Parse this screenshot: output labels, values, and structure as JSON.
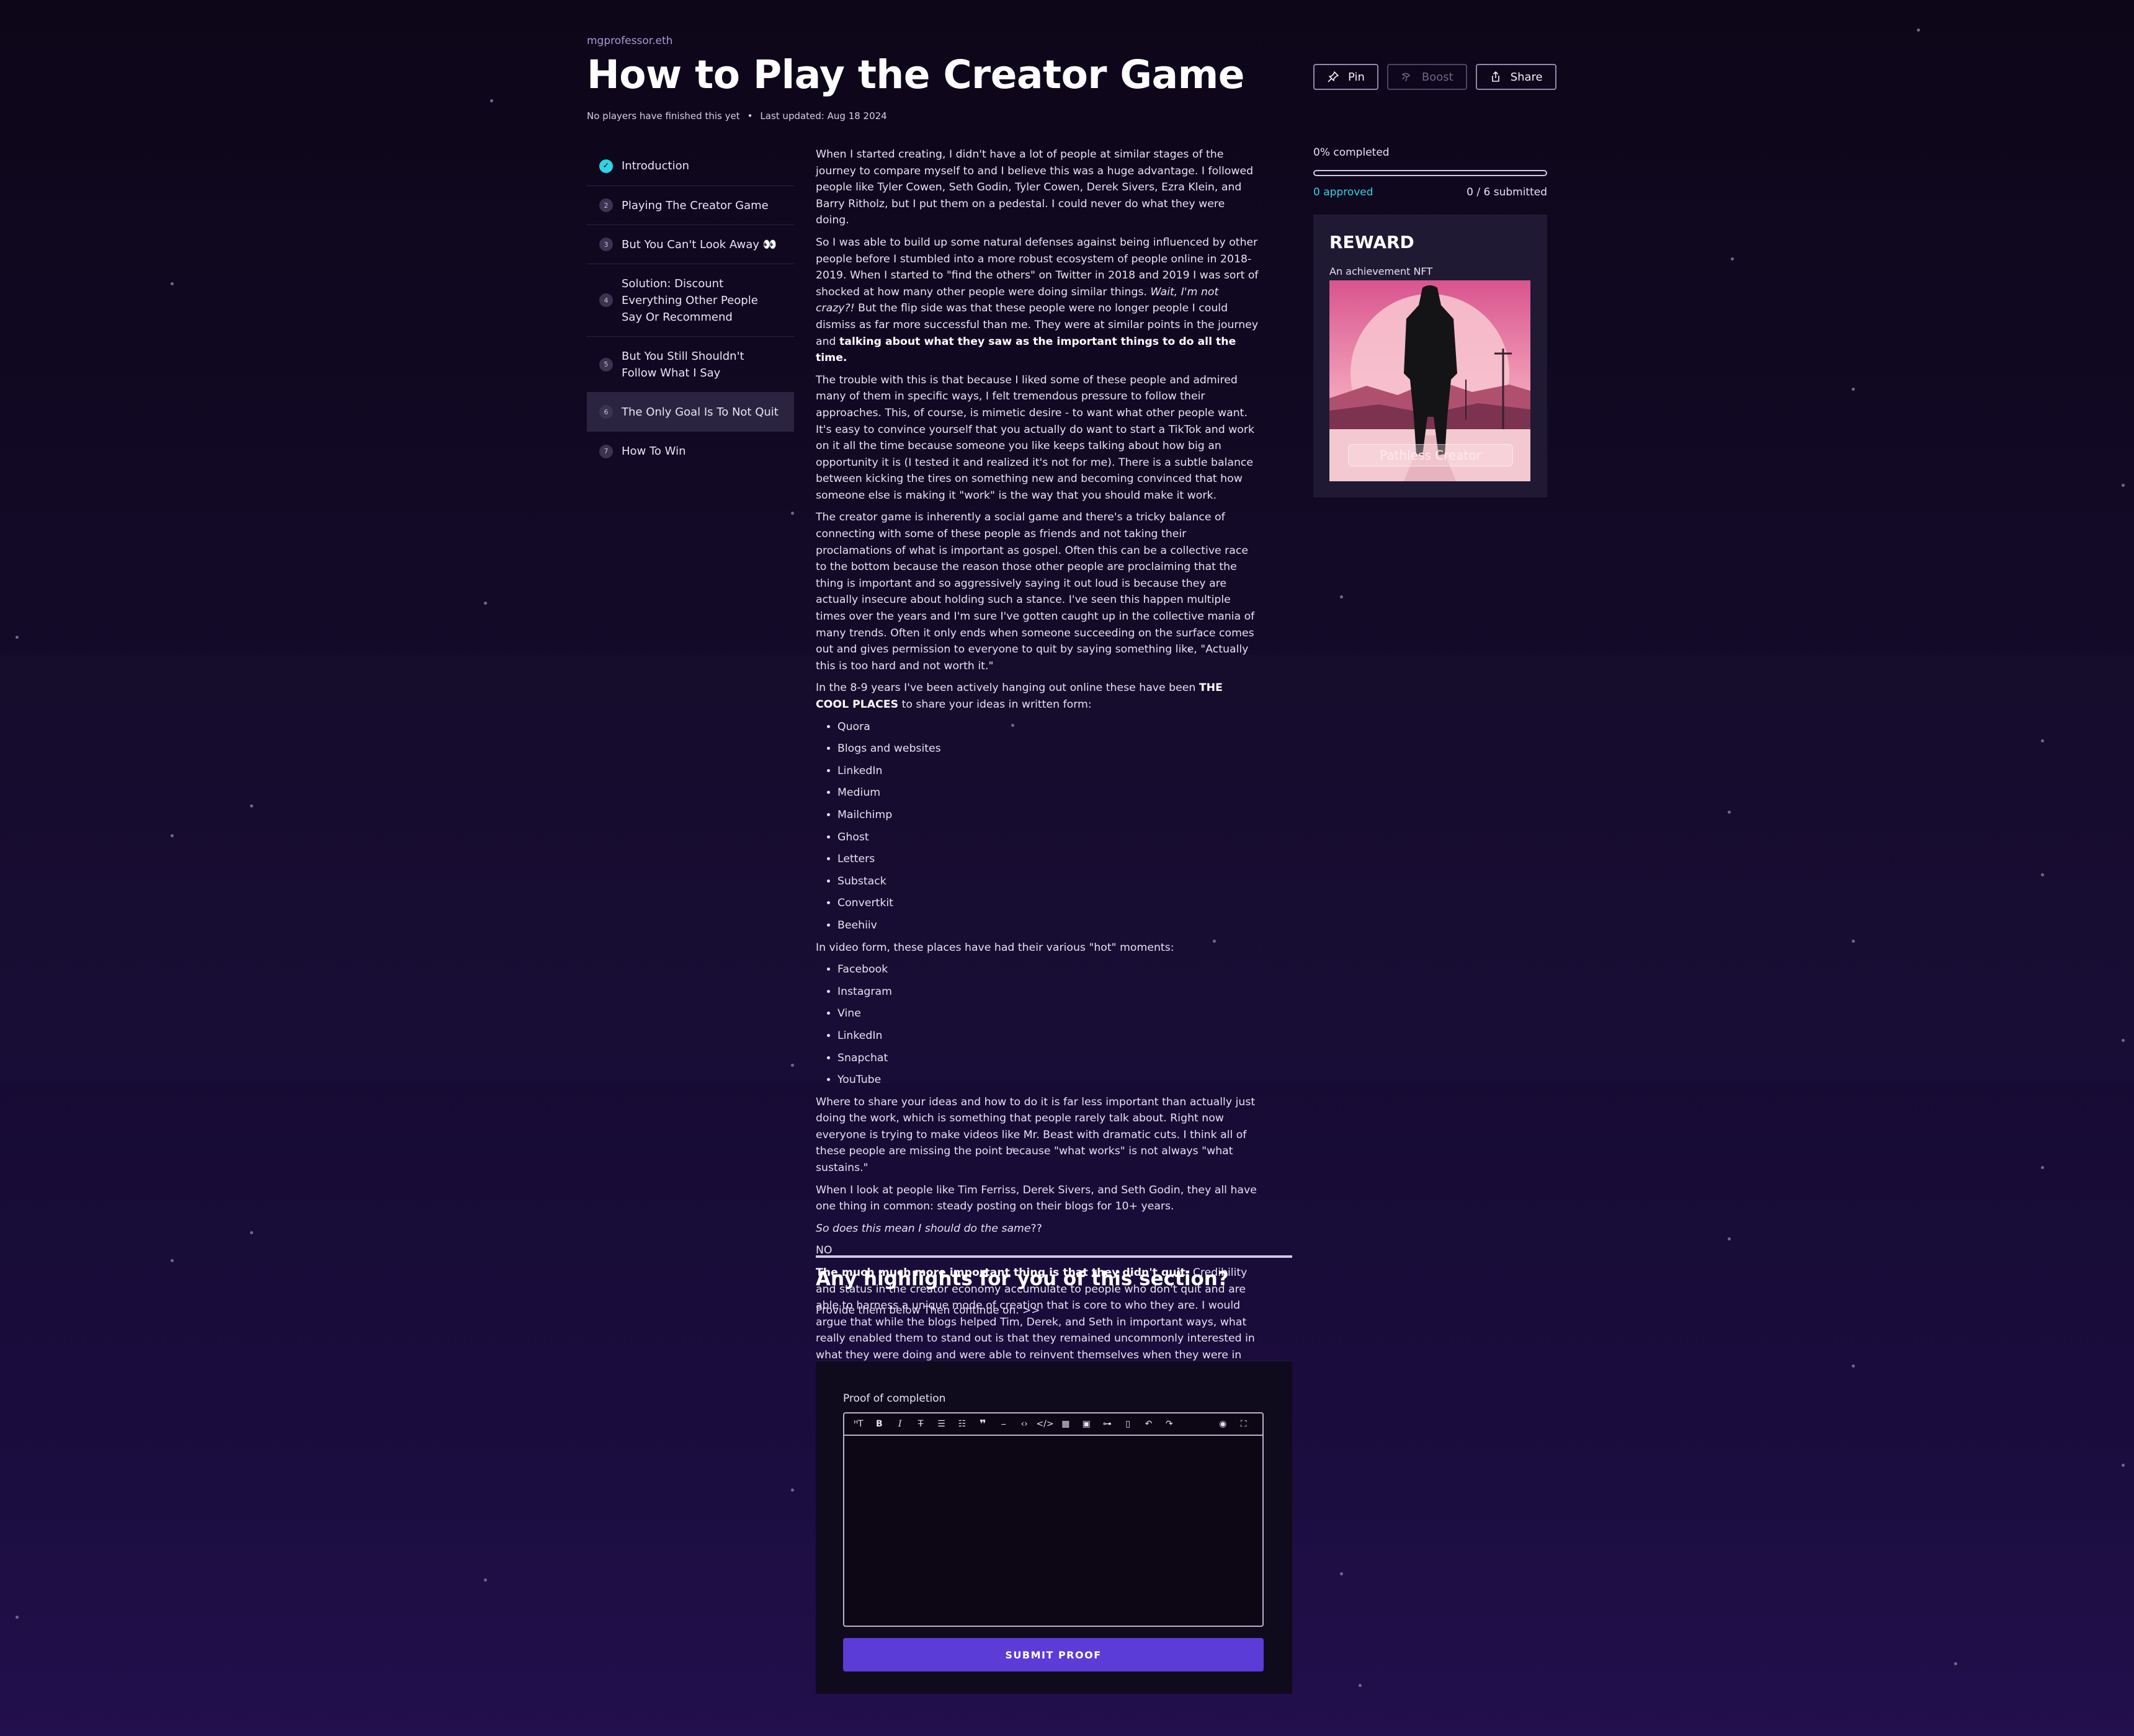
{
  "author": "mgprofessor.eth",
  "title": "How to Play the Creator Game",
  "meta": {
    "players": "No players have finished this yet",
    "updated": "Last updated: Aug 18 2024"
  },
  "actions": {
    "pin": "Pin",
    "boost": "Boost",
    "share": "Share"
  },
  "nav": [
    {
      "num": "✓",
      "label": "Introduction",
      "done": true
    },
    {
      "num": "2",
      "label": "Playing The Creator Game"
    },
    {
      "num": "3",
      "label": "But You Can't Look Away 👀"
    },
    {
      "num": "4",
      "label": "Solution: Discount Everything Other People Say Or Recommend"
    },
    {
      "num": "5",
      "label": "But You Still Shouldn't Follow What I Say"
    },
    {
      "num": "6",
      "label": "The Only Goal Is To Not Quit",
      "active": true
    },
    {
      "num": "7",
      "label": "How To Win"
    }
  ],
  "article": {
    "p1": "When I started creating, I didn't have a lot of people at similar stages of the journey to compare myself to and I believe this was a huge advantage. I followed people like Tyler Cowen, Seth Godin, Tyler Cowen, Derek Sivers, Ezra Klein, and Barry Ritholz, but I put them on a pedestal. I could never do what they were doing.",
    "p2a": "So I was able to build up some natural defenses against being influenced by other people before I stumbled into a more robust ecosystem of people online in 2018-2019. When I started to \"find the others\" on Twitter in 2018 and 2019 I was sort of shocked at how many other people were doing similar things. ",
    "p2b": "Wait, I'm not crazy?!",
    "p2c": " But the flip side was that these people were no longer people I could dismiss as far more successful than me. They were at similar points in the journey and ",
    "p2d": "talking about what they saw as the important things to do all the time.",
    "p3": "The trouble with this is that because I liked some of these people and admired many of them in specific ways, I felt tremendous pressure to follow their approaches. This, of course, is mimetic desire - to want what other people want. It's easy to convince yourself that you actually do want to start a TikTok and work on it all the time because someone you like keeps talking about how big an opportunity it is (I tested it and realized it's not for me). There is a subtle balance between kicking the tires on something new and becoming convinced that how someone else is making it \"work\" is the way that you should make it work.",
    "p4": "The creator game is inherently a social game and there's a tricky balance of connecting with some of these people as friends and not taking their proclamations of what is important as gospel. Often this can be a collective race to the bottom because the reason those other people are proclaiming that the thing is important and so aggressively saying it out loud is because they are actually insecure about holding such a stance. I've seen this happen multiple times over the years and I'm sure I've gotten caught up in the collective mania of many trends. Often it only ends when someone succeeding on the surface comes out and gives permission to everyone to quit by saying something like, \"Actually this is too hard and not worth it.\"",
    "p5a": "In the 8-9 years I've been actively hanging out online these have been ",
    "p5b": "THE COOL PLACES",
    "p5c": " to share your ideas in written form:",
    "written": [
      "Quora",
      "Blogs and websites",
      "LinkedIn",
      "Medium",
      "Mailchimp",
      "Ghost",
      "Letters",
      "Substack",
      "Convertkit",
      "Beehiiv"
    ],
    "p6": "In video form, these places have had their various \"hot\" moments:",
    "video": [
      "Facebook",
      "Instagram",
      "Vine",
      "LinkedIn",
      "Snapchat",
      "YouTube"
    ],
    "p7": "Where to share your ideas and how to do it is far less important than actually just doing the work, which is something that people rarely talk about. Right now everyone is trying to make videos like Mr. Beast with dramatic cuts. I think all of these people are missing the point because \"what works\" is not always \"what sustains.\"",
    "p8": "When I look at people like Tim Ferriss, Derek Sivers, and Seth Godin, they all have one thing in common: steady posting on their blogs for 10+ years.",
    "p9a": "So does this mean I should do the same",
    "p9b": "??",
    "p10": "NO",
    "p11a": "The much much more important thing is that they didn't quit.",
    "p11b": " Credibility and status in the creator economy accumulate to people who don't quit and are able to harness a unique mode of creation that is core to who they are. I would argue that while the blogs helped Tim, Derek, and Seth in important ways, what really enabled them to stand out is that they remained uncommonly interested in what they were doing and were able to reinvent themselves when they were in danger of losing interest in their own path."
  },
  "highlights": {
    "title": "Any highlights for you of this section?",
    "subtitle": "Provide them below Then continue on. >>"
  },
  "proof": {
    "label": "Proof of completion",
    "submit": "SUBMIT PROOF",
    "editor_value": ""
  },
  "progress": {
    "percent_label": "0% completed",
    "fraction": 0,
    "approved": "0 approved",
    "submitted": "0 / 6 submitted"
  },
  "reward": {
    "title": "REWARD",
    "subtitle": "An achievement NFT",
    "nft_name": "Pathless Creator"
  },
  "colors": {
    "accent": "#2fd4e3",
    "primary": "#5b3cd6",
    "author": "#a79bd9"
  },
  "toolbar_icons": [
    "heading-icon",
    "bold-icon",
    "italic-icon",
    "strikethrough-icon",
    "bullet-list-icon",
    "ordered-list-icon",
    "quote-icon",
    "horizontal-rule-icon",
    "inline-code-icon",
    "code-block-icon",
    "table-icon",
    "image-icon",
    "link-icon",
    "clean-block-icon",
    "undo-icon",
    "redo-icon",
    "preview-icon",
    "fullscreen-icon"
  ]
}
